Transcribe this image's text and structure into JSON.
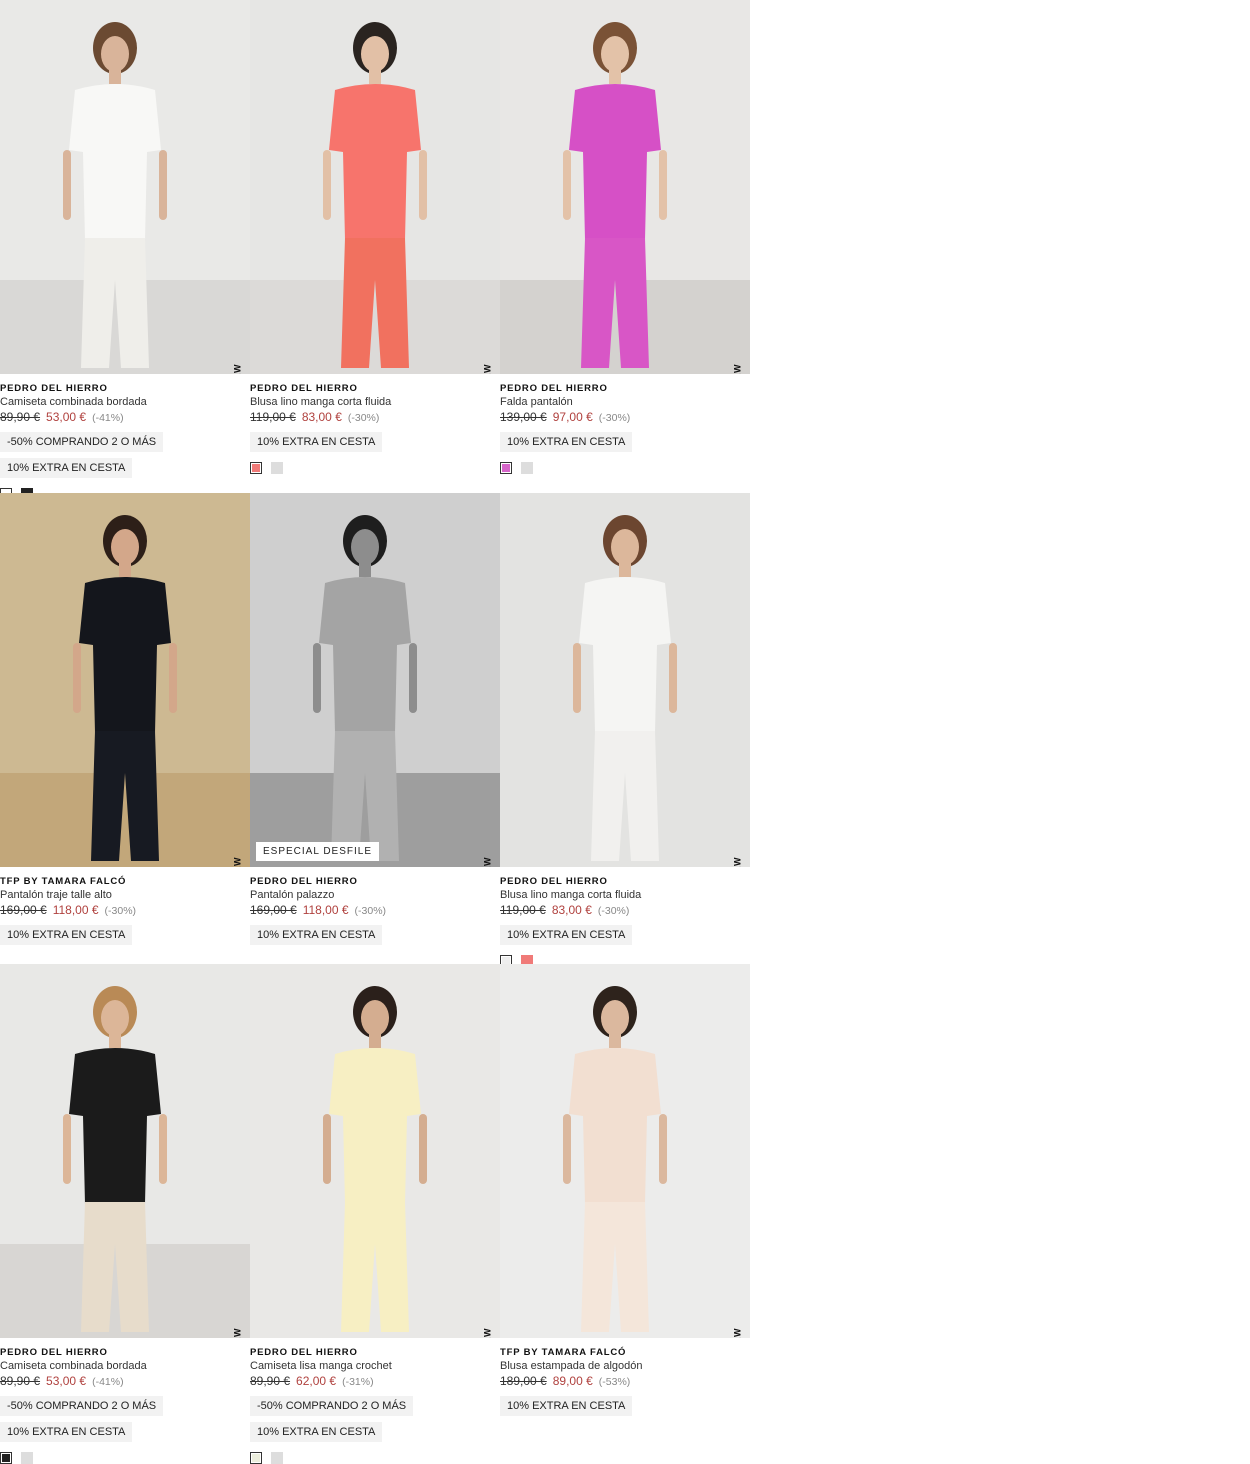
{
  "new_label": "NEW",
  "products": [
    {
      "brand": "PEDRO DEL HIERRO",
      "name": "Camiseta combinada bordada",
      "old_price": "89,90 €",
      "price": "53,00 €",
      "discount": "(-41%)",
      "promos": [
        "-50% COMPRANDO 2 O MÁS",
        "10% EXTRA EN CESTA"
      ],
      "swatches": [
        "#ffffff",
        "#222222"
      ],
      "badge": "",
      "bg": "#e9e9e7",
      "floor": "#d9d8d6",
      "top": "#f8f8f6",
      "bottom": "#efeeea",
      "skin": "#d9b49a",
      "hair": "#6b4a32"
    },
    {
      "brand": "PEDRO DEL HIERRO",
      "name": "Blusa lino manga corta fluida",
      "old_price": "119,00 €",
      "price": "83,00 €",
      "discount": "(-30%)",
      "promos": [
        "10% EXTRA EN CESTA"
      ],
      "swatches": [
        "#f07a78",
        "#dddddd"
      ],
      "badge": "",
      "bg": "#e6e6e4",
      "floor": "#dcdad8",
      "top": "#f7746c",
      "bottom": "#f1715f",
      "skin": "#e2c0a6",
      "hair": "#2a2420"
    },
    {
      "brand": "PEDRO DEL HIERRO",
      "name": "Falda pantalón",
      "old_price": "139,00 €",
      "price": "97,00 €",
      "discount": "(-30%)",
      "promos": [
        "10% EXTRA EN CESTA"
      ],
      "swatches": [
        "#d665c9",
        "#dddddd"
      ],
      "badge": "",
      "bg": "#e8e7e5",
      "floor": "#d4d2cf",
      "top": "#d650c6",
      "bottom": "#d856c6",
      "skin": "#e3c2a8",
      "hair": "#7a5236"
    },
    {
      "brand": "TFP BY TAMARA FALCÓ",
      "name": "Pantalón traje talle alto",
      "old_price": "169,00 €",
      "price": "118,00 €",
      "discount": "(-30%)",
      "promos": [
        "10% EXTRA EN CESTA"
      ],
      "swatches": [],
      "badge": "",
      "bg": "#cdb992",
      "floor": "#c2a77a",
      "top": "#14161c",
      "bottom": "#171a22",
      "skin": "#d3a78a",
      "hair": "#2d1f18"
    },
    {
      "brand": "PEDRO DEL HIERRO",
      "name": "Pantalón palazzo",
      "old_price": "169,00 €",
      "price": "118,00 €",
      "discount": "(-30%)",
      "promos": [
        "10% EXTRA EN CESTA"
      ],
      "swatches": [],
      "badge": "ESPECIAL DESFILE",
      "bg": "#cfcfcf",
      "floor": "#9e9e9e",
      "top": "#a4a4a4",
      "bottom": "#b1b1b1",
      "skin": "#8d8d8d",
      "hair": "#1e1e1e"
    },
    {
      "brand": "PEDRO DEL HIERRO",
      "name": "Blusa lino manga corta fluida",
      "old_price": "119,00 €",
      "price": "83,00 €",
      "discount": "(-30%)",
      "promos": [
        "10% EXTRA EN CESTA"
      ],
      "swatches": [
        "#eeeeee",
        "#f07a78"
      ],
      "badge": "",
      "bg": "#e3e3e1",
      "floor": "#e3e3e1",
      "top": "#f5f5f3",
      "bottom": "#f1f0ee",
      "skin": "#dcb79b",
      "hair": "#6c4630"
    },
    {
      "brand": "PEDRO DEL HIERRO",
      "name": "Camiseta combinada bordada",
      "old_price": "89,90 €",
      "price": "53,00 €",
      "discount": "(-41%)",
      "promos": [
        "-50% COMPRANDO 2 O MÁS",
        "10% EXTRA EN CESTA"
      ],
      "swatches": [
        "#222222",
        "#dddddd"
      ],
      "badge": "",
      "bg": "#e8e8e6",
      "floor": "#d8d6d3",
      "top": "#1b1b1b",
      "bottom": "#e7dccb",
      "skin": "#dcb698",
      "hair": "#b98a56"
    },
    {
      "brand": "PEDRO DEL HIERRO",
      "name": "Camiseta lisa manga crochet",
      "old_price": "89,90 €",
      "price": "62,00 €",
      "discount": "(-31%)",
      "promos": [
        "-50% COMPRANDO 2 O MÁS",
        "10% EXTRA EN CESTA"
      ],
      "swatches": [
        "#eceedd",
        "#dddddd"
      ],
      "badge": "",
      "bg": "#e9e8e6",
      "floor": "#e9e8e6",
      "top": "#f7efc3",
      "bottom": "#f7efc3",
      "skin": "#d4ad90",
      "hair": "#2b201b"
    },
    {
      "brand": "TFP BY TAMARA FALCÓ",
      "name": "Blusa estampada de algodón",
      "old_price": "189,00 €",
      "price": "89,00 €",
      "discount": "(-53%)",
      "promos": [
        "10% EXTRA EN CESTA"
      ],
      "swatches": [],
      "badge": "",
      "bg": "#ececeb",
      "floor": "#ececeb",
      "top": "#f2dfd1",
      "bottom": "#f4e6da",
      "skin": "#dbb89e",
      "hair": "#2e231c"
    }
  ]
}
